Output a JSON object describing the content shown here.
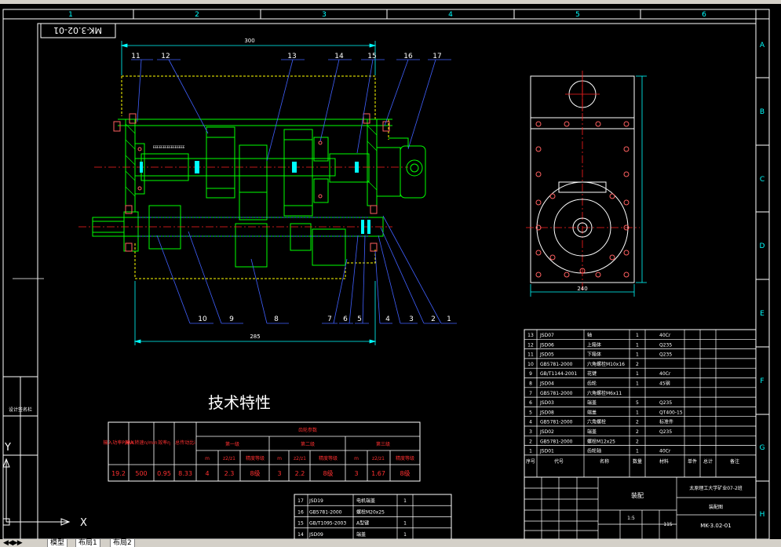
{
  "frame": {
    "columns": [
      "1",
      "2",
      "3",
      "4",
      "5",
      "6"
    ],
    "rows": [
      "A",
      "B",
      "C",
      "D",
      "E",
      "F",
      "G",
      "H"
    ],
    "drawing_code_rotated": "MK-3.02-01"
  },
  "drawing": {
    "dimensions": {
      "top_length": "300",
      "bottom_length": "285",
      "side_width": "240"
    },
    "part_callouts_top": [
      "11",
      "12",
      "13",
      "14",
      "15",
      "16",
      "17"
    ],
    "part_callouts_bottom": [
      "10",
      "9",
      "8",
      "7",
      "6",
      "5",
      "4",
      "3",
      "2",
      "1"
    ],
    "shaft_label": "EEEEEEEEEEEEEEEE"
  },
  "tech_title": "技术特性",
  "tech_table": {
    "headers": [
      "输入功率P/KW",
      "输入转速n/min",
      "效率η",
      "总传动比i"
    ],
    "gear_group": "齿轮参数",
    "stages": [
      "第一级",
      "第二级",
      "第三级"
    ],
    "sub_headers": [
      "m",
      "z2/z1",
      "精度等级"
    ],
    "values": [
      "19.2",
      "500",
      "0.95",
      "8.33",
      "4",
      "2.3",
      "8级",
      "3",
      "2.2",
      "8级",
      "3",
      "1.67",
      "8级"
    ]
  },
  "bom_main": {
    "rows": [
      {
        "no": "13",
        "code": "JSD07",
        "name": "轴",
        "qty": "1",
        "material": "40Cr"
      },
      {
        "no": "12",
        "code": "JSD06",
        "name": "上箱体",
        "qty": "1",
        "material": "Q235"
      },
      {
        "no": "11",
        "code": "JSD05",
        "name": "下箱体",
        "qty": "1",
        "material": "Q235"
      },
      {
        "no": "10",
        "code": "GB5781-2000",
        "name": "六角螺栓M10x16",
        "qty": "2",
        "material": ""
      },
      {
        "no": "9",
        "code": "GB/T1144-2001",
        "name": "花键",
        "qty": "1",
        "material": "40Cr"
      },
      {
        "no": "8",
        "code": "JSD04",
        "name": "齿轮",
        "qty": "1",
        "material": "45钢"
      },
      {
        "no": "7",
        "code": "GB5781-2000",
        "name": "六角螺栓M6x11",
        "qty": "",
        "material": ""
      },
      {
        "no": "6",
        "code": "JSD03",
        "name": "端盖",
        "qty": "5",
        "material": "Q235"
      },
      {
        "no": "5",
        "code": "JSD08",
        "name": "端盖",
        "qty": "1",
        "material": "QT400-15"
      },
      {
        "no": "4",
        "code": "GB5781-2000",
        "name": "六角螺栓",
        "qty": "2",
        "material": "标准件"
      },
      {
        "no": "3",
        "code": "JSD02",
        "name": "端盖",
        "qty": "2",
        "material": "Q235"
      },
      {
        "no": "2",
        "code": "GB5781-2000",
        "name": "螺栓M12x25",
        "qty": "2",
        "material": ""
      },
      {
        "no": "1",
        "code": "JSD01",
        "name": "齿轮轴",
        "qty": "1",
        "material": "40Cr"
      }
    ],
    "header": [
      "序号",
      "代号",
      "名称",
      "数量",
      "材料",
      "单件",
      "总计",
      "备注"
    ]
  },
  "bom_lower": {
    "rows": [
      {
        "no": "17",
        "code": "JSD19",
        "name": "电机端盖",
        "qty": "1"
      },
      {
        "no": "16",
        "code": "GB5781-2000",
        "name": "螺栓M20x25",
        "qty": ""
      },
      {
        "no": "15",
        "code": "GB/T1095-2003",
        "name": "A型键",
        "qty": "1"
      },
      {
        "no": "14",
        "code": "JSD09",
        "name": "端盖",
        "qty": "1"
      }
    ]
  },
  "title_block": {
    "left_label": "装配",
    "company": "太原理工大学矿业07-2班",
    "drawing_no": "MK-3.02-01",
    "assembly": "装配图",
    "scale": "1:5",
    "sheet": "115"
  },
  "side_stamp": "设计签名栏",
  "axes": {
    "y": "Y",
    "x": "X"
  },
  "tabs": {
    "nav": "◀◀▶▶",
    "items": [
      "模型",
      "布局1",
      "布局2"
    ]
  },
  "colors": {
    "bg": "#000000",
    "frame": "#ffffff",
    "dim": "#00ffff",
    "part": "#00ff00",
    "leader": "#4060ff",
    "hidden": "#ffff00",
    "center": "#ff2020",
    "bolt": "#ff6060",
    "table": "#ff3030"
  }
}
